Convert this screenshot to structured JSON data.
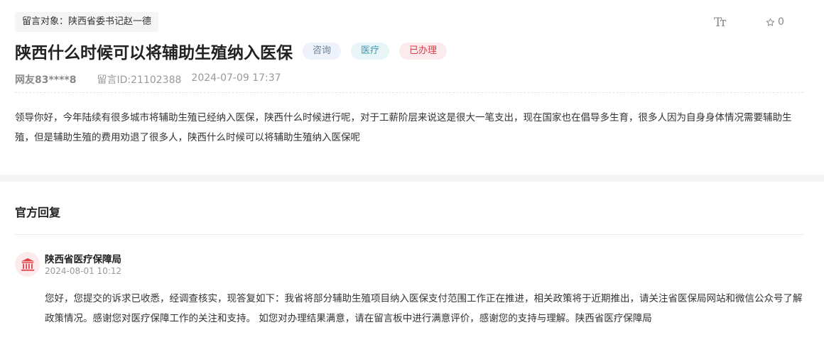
{
  "header": {
    "target_label": "留言对象：陕西省委书记赵一德",
    "font_tool_label": "Tт",
    "favorite_count": "0"
  },
  "message": {
    "title": "陕西什么时候可以将辅助生殖纳入医保",
    "tags": [
      {
        "label": "咨询",
        "color": "#6c7f9c"
      },
      {
        "label": "医疗",
        "color": "#3b95b0"
      },
      {
        "label": "已办理",
        "color": "#d4414a"
      }
    ],
    "user": "网友83****8",
    "message_id": "留言ID:21102388",
    "datetime": "2024-07-09 17:37",
    "content": "领导你好，今年陆续有很多城市将辅助生殖已经纳入医保，陕西什么时候进行呢，对于工薪阶层来说这是很大一笔支出，现在国家也在倡导多生育，很多人因为自身身体情况需要辅助生殖，但是辅助生殖的费用劝退了很多人，陕西什么时候可以将辅助生殖纳入医保呢"
  },
  "reply": {
    "heading": "官方回复",
    "org_name": "陕西省医疗保障局",
    "date": "2024-08-01 10:12",
    "content": "您好，您提交的诉求已收悉，经调查核实，现答复如下：我省将部分辅助生殖项目纳入医保支付范围工作正在推进，相关政策将于近期推出，请关注省医保局网站和微信公众号了解政策情况。感谢您对医疗保障工作的关注和支持。 如您对办理结果满意，请在留言板中进行满意评价，感谢您的支持与理解。陕西省医疗保障局",
    "avatar_icon": "government-building-icon"
  }
}
